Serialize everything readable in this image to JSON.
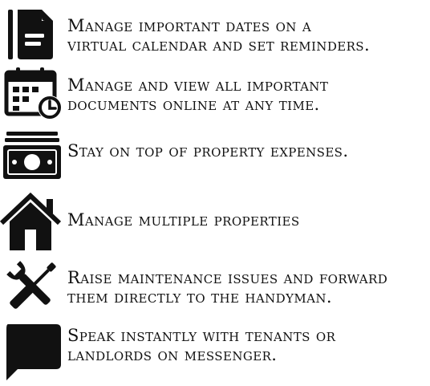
{
  "features": [
    {
      "icon": "document-icon",
      "lines": [
        "Manage important dates on a",
        "virtual calendar and set reminders."
      ]
    },
    {
      "icon": "calendar-clock-icon",
      "lines": [
        "Manage and view all important",
        "documents online at any time."
      ]
    },
    {
      "icon": "cash-stack-icon",
      "lines": [
        "Stay on top of property expenses."
      ]
    },
    {
      "icon": "house-icon",
      "lines": [
        "Manage multiple properties"
      ]
    },
    {
      "icon": "wrench-screwdriver-icon",
      "lines": [
        "Raise maintenance issues and forward",
        "them directly to the handyman."
      ]
    },
    {
      "icon": "chat-bubble-icon",
      "lines": [
        "Speak instantly with tenants or",
        "landlords on messenger."
      ]
    }
  ],
  "colors": {
    "icon": "#111111",
    "text": "#111111",
    "background": "#ffffff"
  }
}
